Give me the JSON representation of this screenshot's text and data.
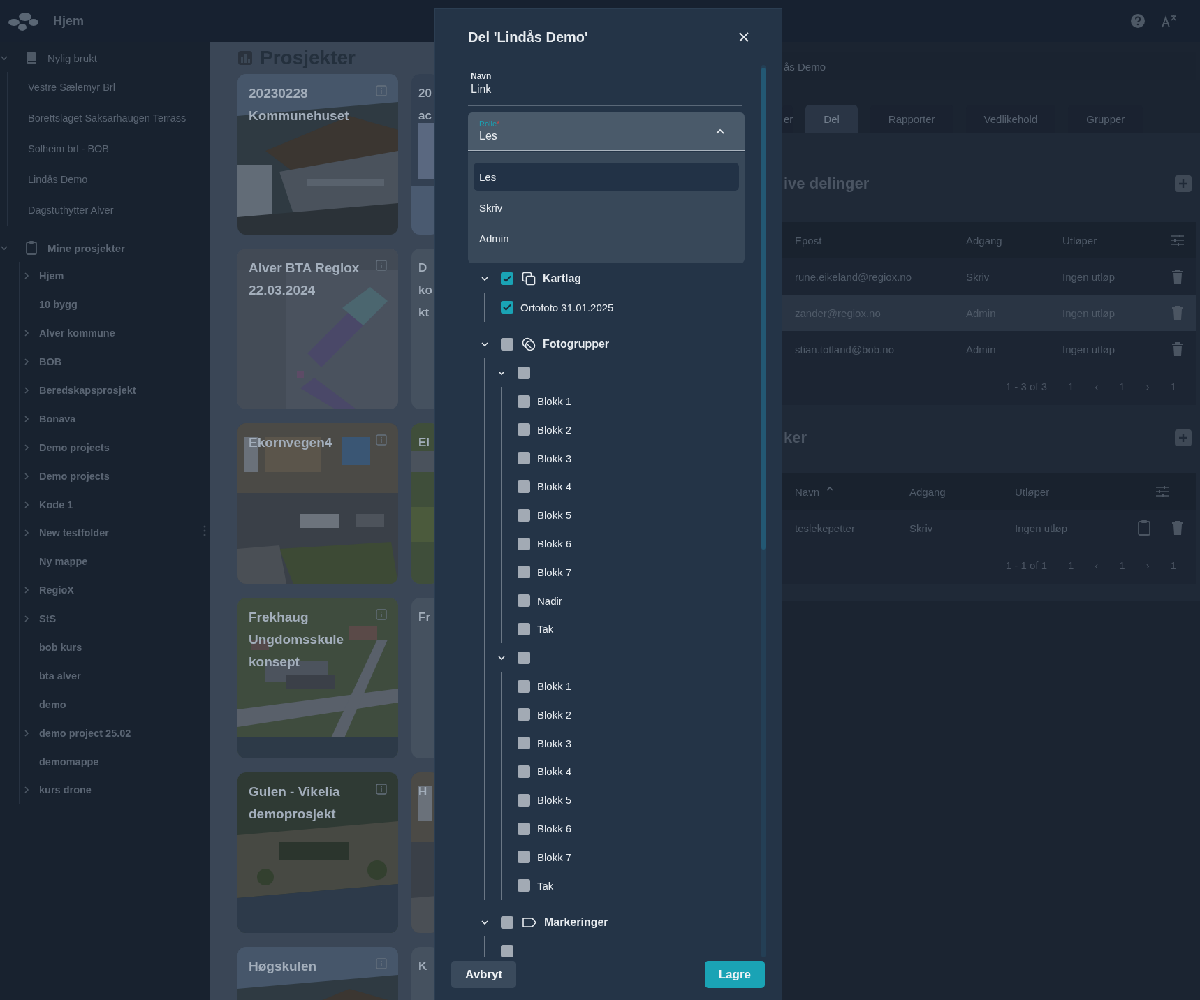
{
  "topbar": {
    "title": "Hjem"
  },
  "sidebar": {
    "sections": [
      {
        "label": "Nylig brukt",
        "expanded": true,
        "items": [
          {
            "label": "Vestre Sælemyr Brl",
            "kind": "item"
          },
          {
            "label": "Borettslaget Saksarhaugen Terrass",
            "kind": "item"
          },
          {
            "label": "Solheim brl - BOB",
            "kind": "item"
          },
          {
            "label": "Lindås Demo",
            "kind": "item"
          },
          {
            "label": "Dagstuthytter Alver",
            "kind": "item"
          }
        ]
      },
      {
        "label": "Mine prosjekter",
        "expanded": true,
        "items": [
          {
            "label": "Hjem",
            "kind": "group"
          },
          {
            "label": "10 bygg",
            "kind": "item"
          },
          {
            "label": "Alver kommune",
            "kind": "group"
          },
          {
            "label": "BOB",
            "kind": "group"
          },
          {
            "label": "Beredskapsprosjekt",
            "kind": "group"
          },
          {
            "label": "Bonava",
            "kind": "group"
          },
          {
            "label": "Demo projects",
            "kind": "group"
          },
          {
            "label": "Demo projects",
            "kind": "group"
          },
          {
            "label": "Kode 1",
            "kind": "group"
          },
          {
            "label": "New testfolder",
            "kind": "group"
          },
          {
            "label": "Ny mappe",
            "kind": "item"
          },
          {
            "label": "RegioX",
            "kind": "group"
          },
          {
            "label": "StS",
            "kind": "group"
          },
          {
            "label": "bob kurs",
            "kind": "item"
          },
          {
            "label": "bta alver",
            "kind": "item"
          },
          {
            "label": "demo",
            "kind": "item"
          },
          {
            "label": "demo project 25.02",
            "kind": "group"
          },
          {
            "label": "demomappe",
            "kind": "item"
          },
          {
            "label": "kurs drone",
            "kind": "group"
          }
        ]
      }
    ]
  },
  "projects": {
    "title": "Prosjekter",
    "cards": [
      {
        "title": "20230228 Kommunehuset",
        "kind": "picture"
      },
      {
        "title": "Alver BTA Regiox 22.03.2024",
        "kind": "picture"
      },
      {
        "title": "Ekornvegen4",
        "kind": "picture"
      },
      {
        "title": "Frekhaug Ungdomsskule konsept",
        "kind": "picture"
      },
      {
        "title": "Gulen - Vikelia demoprosjekt",
        "kind": "picture"
      },
      {
        "title": "Høgskulen",
        "kind": "picture"
      }
    ],
    "cards_partial": [
      {
        "title": "20 ac",
        "kind": "picture"
      },
      {
        "title": "D ko kt",
        "kind": "plain"
      },
      {
        "title": "El",
        "kind": "picture"
      },
      {
        "title": "Fr",
        "kind": "plain"
      },
      {
        "title": "H",
        "kind": "picture"
      },
      {
        "title": "K",
        "kind": "plain"
      }
    ]
  },
  "details": {
    "breadcrumb": "ås Demo",
    "tabs": [
      {
        "label": "er",
        "selected": false
      },
      {
        "label": "Del",
        "selected": true
      },
      {
        "label": "Rapporter",
        "selected": false
      },
      {
        "label": "Vedlikehold",
        "selected": false
      },
      {
        "label": "Grupper",
        "selected": false
      }
    ],
    "sections": [
      {
        "title": "ive delinger",
        "kind": "users",
        "columns": [
          {
            "label": "Epost",
            "sorted": false
          },
          {
            "label": "Adgang",
            "sorted": false
          },
          {
            "label": "Utløper",
            "sorted": false
          }
        ],
        "rows": [
          {
            "cells": [
              "rune.eikeland@regiox.no",
              "Skriv",
              "Ingen utløp"
            ],
            "selected": false
          },
          {
            "cells": [
              "zander@regiox.no",
              "Admin",
              "Ingen utløp"
            ],
            "selected": true
          },
          {
            "cells": [
              "stian.totland@bob.no",
              "Admin",
              "Ingen utløp"
            ],
            "selected": false
          }
        ],
        "pagination": [
          "1 - 3 of 3",
          "1",
          "‹",
          "1",
          "›",
          "1"
        ]
      },
      {
        "title": "ker",
        "kind": "links",
        "columns": [
          {
            "label": "Navn",
            "sorted": true
          },
          {
            "label": "Adgang",
            "sorted": false
          },
          {
            "label": "Utløper",
            "sorted": false
          }
        ],
        "rows": [
          {
            "cells": [
              "teslekepetter",
              "Skriv",
              "Ingen utløp"
            ],
            "selected": false
          }
        ],
        "pagination": [
          "1 - 1 of 1",
          "1",
          "‹",
          "1",
          "›",
          "1"
        ]
      }
    ]
  },
  "modal": {
    "title": "Del 'Lindås Demo'",
    "name_field": {
      "label": "Navn",
      "value": "Link"
    },
    "role_field": {
      "label": "Rolle",
      "required_mark": "*",
      "value": "Les",
      "open": true,
      "options": [
        {
          "label": "Les",
          "selected": true
        },
        {
          "label": "Skriv",
          "selected": false
        },
        {
          "label": "Admin",
          "selected": false
        }
      ]
    },
    "tree": [
      {
        "label": "Kartlag",
        "checked": true,
        "expanded": true,
        "children": [
          {
            "label": "Ortofoto 31.01.2025",
            "checked": true
          }
        ]
      },
      {
        "label": "Fotogrupper",
        "checked": false,
        "expanded": true,
        "children": [
          {
            "checked": false,
            "expanded": true,
            "children": [
              {
                "label": "Blokk 1",
                "checked": false
              },
              {
                "label": "Blokk 2",
                "checked": false
              },
              {
                "label": "Blokk 3",
                "checked": false
              },
              {
                "label": "Blokk 4",
                "checked": false
              },
              {
                "label": "Blokk 5",
                "checked": false
              },
              {
                "label": "Blokk 6",
                "checked": false
              },
              {
                "label": "Blokk 7",
                "checked": false
              },
              {
                "label": "Nadir",
                "checked": false
              },
              {
                "label": "Tak",
                "checked": false
              }
            ]
          },
          {
            "checked": false,
            "expanded": true,
            "children": [
              {
                "label": "Blokk 1",
                "checked": false
              },
              {
                "label": "Blokk 2",
                "checked": false
              },
              {
                "label": "Blokk 3",
                "checked": false
              },
              {
                "label": "Blokk 4",
                "checked": false
              },
              {
                "label": "Blokk 5",
                "checked": false
              },
              {
                "label": "Blokk 6",
                "checked": false
              },
              {
                "label": "Blokk 7",
                "checked": false
              },
              {
                "label": "Tak",
                "checked": false
              }
            ]
          }
        ]
      },
      {
        "label": "Markeringer",
        "checked": false,
        "expanded": true,
        "children": [
          {
            "checked": false
          }
        ]
      }
    ],
    "buttons": [
      {
        "label": "Avbryt",
        "kind": "secondary"
      },
      {
        "label": "Lagre",
        "kind": "primary"
      }
    ]
  }
}
